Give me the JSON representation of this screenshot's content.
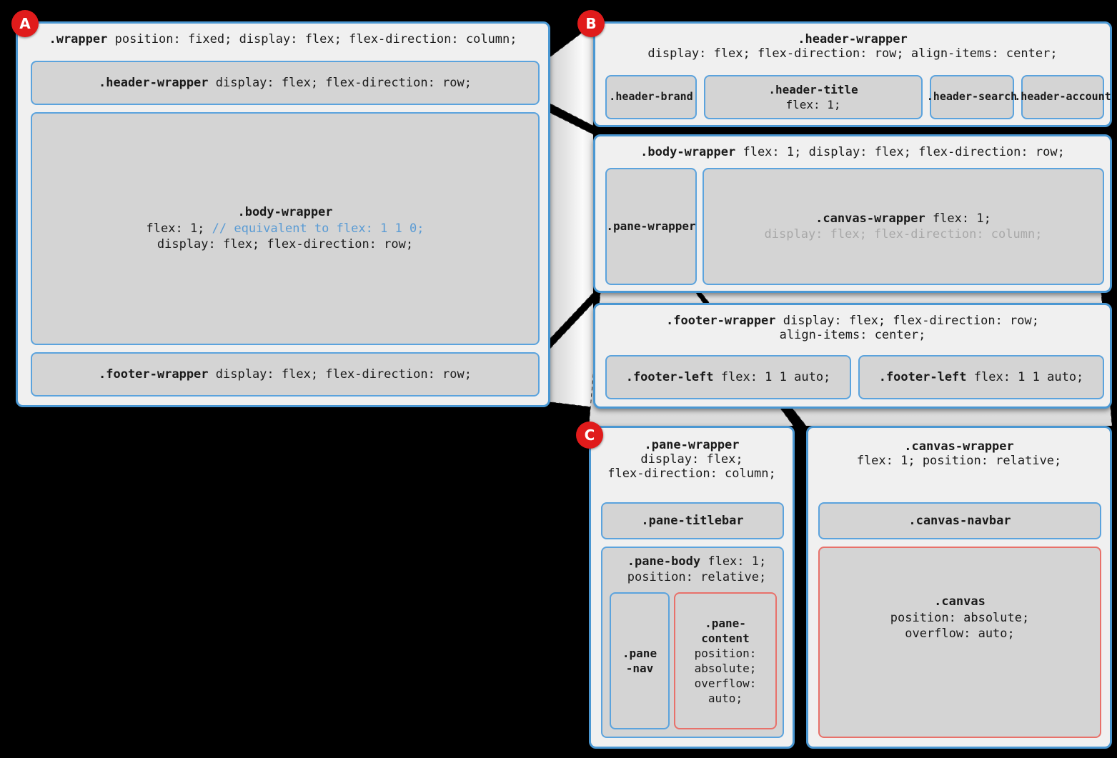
{
  "diagram": {
    "title": "CSS flexbox layout wrapper structure",
    "accent_blue": "#4a97d2",
    "accent_red": "#e8716a",
    "badge_color": "#e01b1b",
    "box_fill": "#d4d4d4",
    "panel_fill": "#f0f0f0",
    "comment_color": "#5a9bd4",
    "dim_color": "#a8a8a8"
  },
  "badges": {
    "a": "A",
    "b": "B",
    "c": "C"
  },
  "panel_a": {
    "wrapper": {
      "selector": ".wrapper",
      "rules": " position: fixed; display: flex; flex-direction: column;"
    },
    "header_wrapper": {
      "selector": ".header-wrapper",
      "rules": " display: flex; flex-direction: row;"
    },
    "body_wrapper": {
      "selector": ".body-wrapper",
      "line1_pre": "flex: 1; ",
      "line1_comment": "// equivalent to flex: 1 1 0;",
      "line2": "display: flex; flex-direction: row;"
    },
    "footer_wrapper": {
      "selector": ".footer-wrapper",
      "rules": " display: flex; flex-direction: row;"
    }
  },
  "panel_b_header": {
    "header_wrapper": {
      "selector": ".header-wrapper",
      "rules": "display: flex; flex-direction: row; align-items: center;"
    },
    "children": [
      {
        "selector": ".header-⁠brand",
        "rules": ""
      },
      {
        "selector": ".header-title",
        "rules": "flex: 1;"
      },
      {
        "selector": ".header-⁠search",
        "rules": ""
      },
      {
        "selector": ".header-⁠account",
        "rules": ""
      }
    ]
  },
  "panel_b_body": {
    "body_wrapper": {
      "selector": ".body-wrapper",
      "rules": " flex: 1; display: flex; flex-direction: row;"
    },
    "pane_wrapper": {
      "selector": ".pane-⁠wrapper"
    },
    "canvas_wrapper": {
      "selector": ".canvas-wrapper",
      "rules": " flex: 1;",
      "dim_rules": "display: flex; flex-direction: column;"
    }
  },
  "panel_b_footer": {
    "footer_wrapper": {
      "selector": ".footer-wrapper",
      "line1": " display: flex; flex-direction: row;",
      "line2": "align-items: center;"
    },
    "children": [
      {
        "selector": ".footer-left",
        "rules": " flex: 1 1 auto;"
      },
      {
        "selector": ".footer-left",
        "rules": " flex: 1 1 auto;"
      }
    ]
  },
  "panel_c_pane": {
    "pane_wrapper": {
      "selector": ".pane-wrapper",
      "line1": "display: flex;",
      "line2": "flex-direction: column;"
    },
    "pane_titlebar": {
      "selector": ".pane-titlebar"
    },
    "pane_body": {
      "selector": ".pane-body",
      "rules": " flex: 1;",
      "line2": "position: relative;"
    },
    "pane_nav": {
      "selector": ".pane",
      "selector2": "-nav"
    },
    "pane_content": {
      "selector": ".pane-",
      "selector2": "content",
      "line1": "position:",
      "line2": "absolute;",
      "line3": "overflow:",
      "line4": "auto;"
    }
  },
  "panel_c_canvas": {
    "canvas_wrapper": {
      "selector": ".canvas-wrapper",
      "rules": "flex: 1; position: relative;"
    },
    "canvas_navbar": {
      "selector": ".canvas-navbar"
    },
    "canvas": {
      "selector": ".canvas",
      "line1": "position: absolute;",
      "line2": "overflow: auto;"
    }
  }
}
